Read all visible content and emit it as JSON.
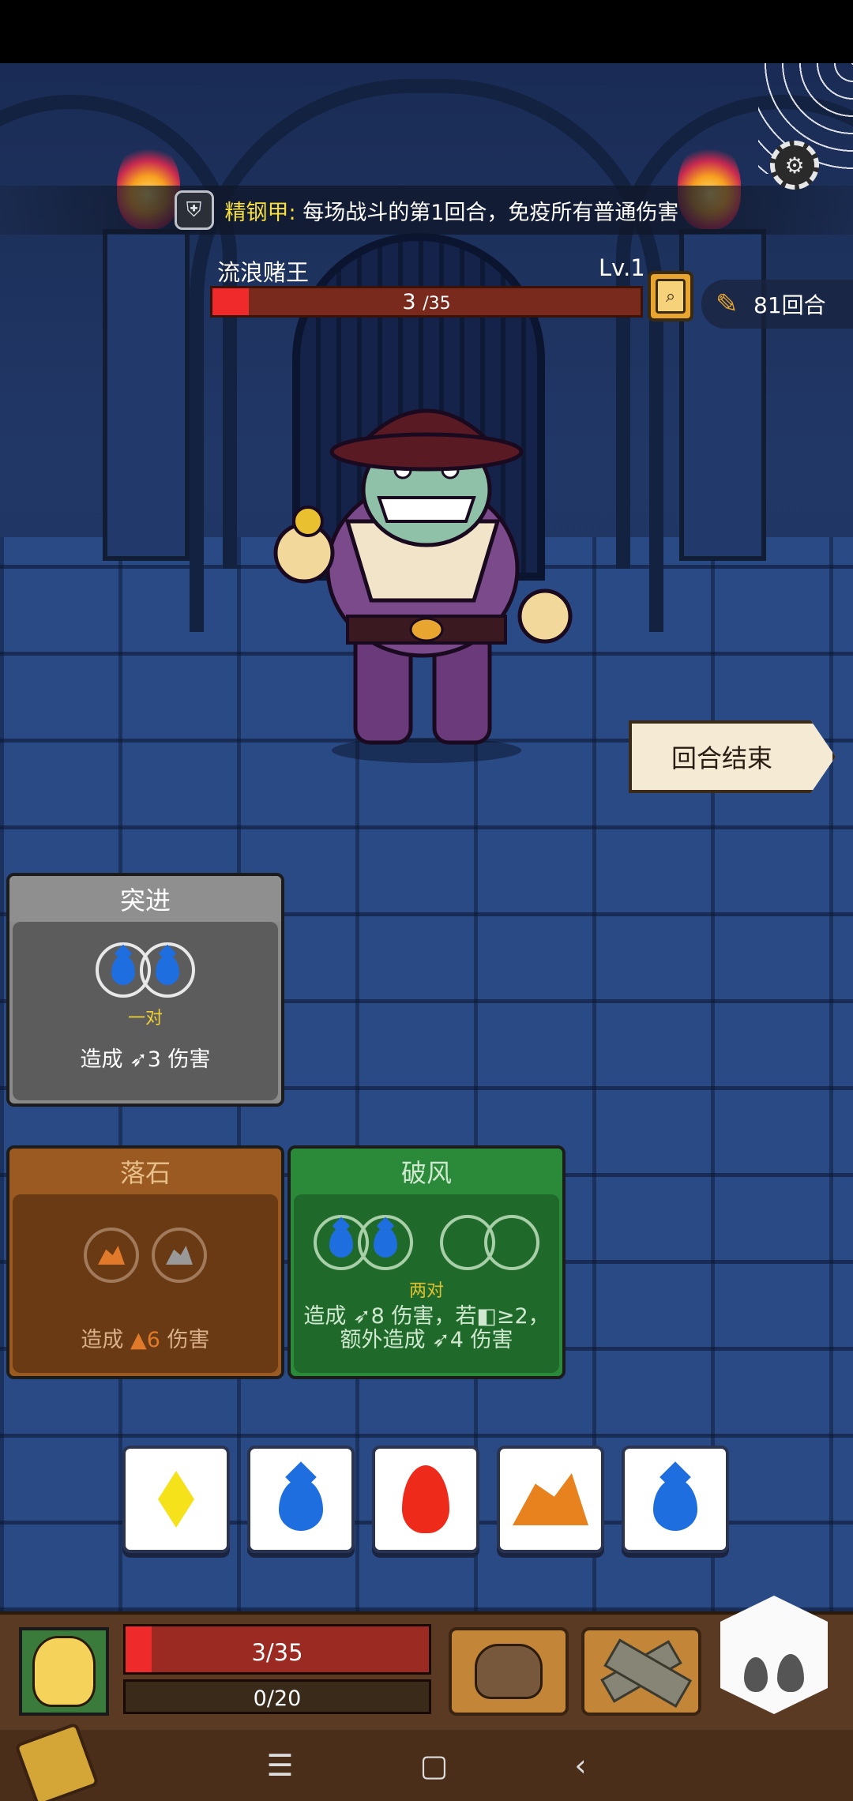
{
  "perk": {
    "name": "精钢甲",
    "separator": ":",
    "description": "每场战斗的第1回合，免疫所有普通伤害",
    "icon": "armor-icon"
  },
  "enemy": {
    "name": "流浪赌王",
    "level": "Lv.1",
    "hp_current": "3",
    "hp_max": "/35",
    "hp_fraction": 0.0857
  },
  "round": {
    "label": "81回合",
    "icon": "scroll-icon"
  },
  "end_turn_label": "回合结束",
  "cards": {
    "charge": {
      "title": "突进",
      "condition": "一对",
      "desc": "造成 ➶3 伤害"
    },
    "rockfall": {
      "title": "落石",
      "desc_prefix": "造成 ",
      "desc_value": "▲6",
      "desc_suffix": " 伤害"
    },
    "windbreak": {
      "title": "破风",
      "condition": "两对",
      "desc": "造成 ➶8 伤害，若◧≥2，额外造成 ➶4 伤害"
    }
  },
  "dice": [
    {
      "face": "lightning",
      "color": "#f5e21a"
    },
    {
      "face": "water",
      "color": "#1f6ee0"
    },
    {
      "face": "fire",
      "color": "#ee2a1a"
    },
    {
      "face": "earth",
      "color": "#e8821e"
    },
    {
      "face": "water",
      "color": "#1f6ee0"
    }
  ],
  "player": {
    "hp_text": "3/35",
    "hp_fraction": 0.0857,
    "shield_text": "0/20"
  },
  "nav": {
    "menu": "☰",
    "home": "▢",
    "back": "‹"
  },
  "colors": {
    "perk_name": "#f8df3a",
    "hp_red": "#f02a2a",
    "card_green": "#1f6a2a",
    "card_brown": "#6a3a14",
    "card_grey": "#5a5a5a"
  }
}
